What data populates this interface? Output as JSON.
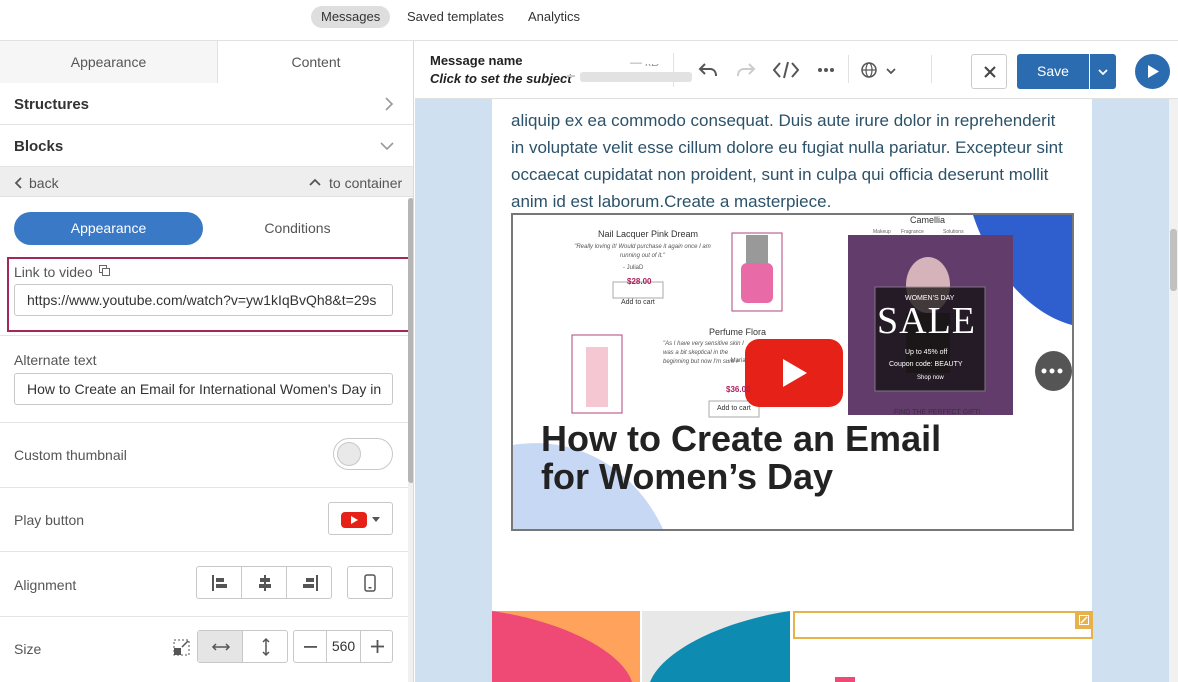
{
  "top_nav": {
    "messages": "Messages",
    "saved_templates": "Saved templates",
    "analytics": "Analytics"
  },
  "panel_tabs": {
    "appearance": "Appearance",
    "content": "Content"
  },
  "sections": {
    "structures": "Structures",
    "blocks": "Blocks"
  },
  "nav": {
    "back": "back",
    "to_container": "to container"
  },
  "block_tabs": {
    "appearance": "Appearance",
    "conditions": "Conditions"
  },
  "fields": {
    "link_to_video_label": "Link to video",
    "link_to_video_value": "https://www.youtube.com/watch?v=yw1kIqBvQh8&t=29s",
    "alternate_text_label": "Alternate text",
    "alternate_text_value": "How to Create an Email for International Women's Day in",
    "custom_thumbnail_label": "Custom thumbnail",
    "play_button_label": "Play button",
    "alignment_label": "Alignment",
    "size_label": "Size",
    "size_value": "560"
  },
  "toolbar": {
    "message_name": "Message name",
    "subject_hint": "Click to set the subject",
    "kb": "— kB",
    "save": "Save"
  },
  "canvas": {
    "body_text": "aliquip ex ea commodo consequat. Duis aute irure dolor in reprehenderit in voluptate velit esse cillum dolore eu fugiat nulla pariatur. Excepteur sint occaecat cupidatat non proident, sunt in culpa qui officia deserunt mollit anim id est laborum.Create a masterpiece."
  },
  "thumbnail": {
    "product1_name": "Nail Lacquer Pink Dream",
    "product1_quote": "\"Really loving it! Would purchase it again once I am running out of it.\"",
    "product1_author": "- JuliaD",
    "product1_price": "$28.00",
    "add_to_cart": "Add to cart",
    "product2_name": "Perfume Flora",
    "product2_quote": "\"As I have very sensitive skin I was a bit skeptical in the beginning but now I'm sure I would definitely recommend it.\"",
    "product2_author": "- Maria",
    "product2_price": "$36.00",
    "brand": "Camellia",
    "menu1": "Makeup",
    "menu2": "Fragrance",
    "menu3": "Solutions",
    "sale_kicker": "WOMEN'S DAY",
    "sale": "SALE",
    "sale_upto": "Up to 45% off",
    "sale_coupon": "Coupon code: BEAUTY",
    "shop_now": "Shop now",
    "find_gift": "FIND THE PERFECT GIFT!",
    "headline_1": "How to Create an Email",
    "headline_2": "for Women’s Day"
  },
  "colors": {
    "accent": "#3a79c5",
    "save_button": "#2b6cb0",
    "highlight_border": "#a32857",
    "body_text": "#2c5269",
    "canvas_bg": "#cfe0f1",
    "youtube_red": "#e62117",
    "selection_orange": "#e8b24b"
  }
}
